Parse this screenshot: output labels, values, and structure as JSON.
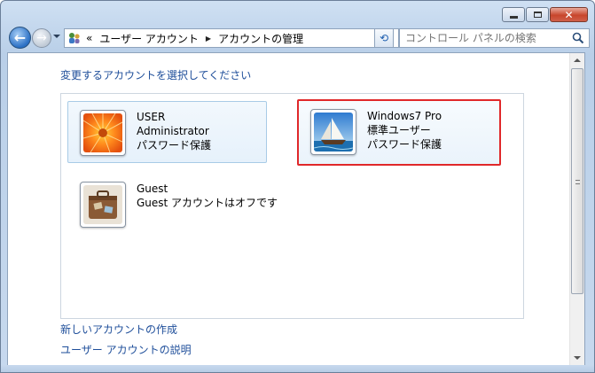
{
  "window": {
    "caption_buttons": {
      "minimize_icon": "minimize-icon",
      "maximize_icon": "maximize-icon",
      "close_icon": "close-icon",
      "close_glyph": "✕"
    }
  },
  "navigation": {
    "back_glyph": "←",
    "forward_glyph": "→",
    "address": {
      "overflow_chevron": "«",
      "crumbs": [
        "ユーザー アカウント",
        "アカウントの管理"
      ]
    },
    "refresh_glyph": "⟲",
    "search": {
      "placeholder": "コントロール パネルの検索"
    }
  },
  "main": {
    "title": "変更するアカウントを選択してください",
    "accounts": [
      {
        "name": "USER",
        "type": "Administrator",
        "status": "パスワード保護",
        "picture": "flower",
        "selected": true
      },
      {
        "name": "Windows7 Pro",
        "type": "標準ユーザー",
        "status": "パスワード保護",
        "picture": "sailboat",
        "highlighted": true
      },
      {
        "name": "Guest",
        "type": "Guest アカウントはオフです",
        "picture": "suitcase"
      }
    ],
    "links": {
      "create_account": "新しいアカウントの作成",
      "about_accounts": "ユーザー アカウントの説明"
    }
  },
  "colors": {
    "link": "#1e4e9a",
    "highlight_border": "#e0282a",
    "selection_border": "#a8cbe6"
  }
}
